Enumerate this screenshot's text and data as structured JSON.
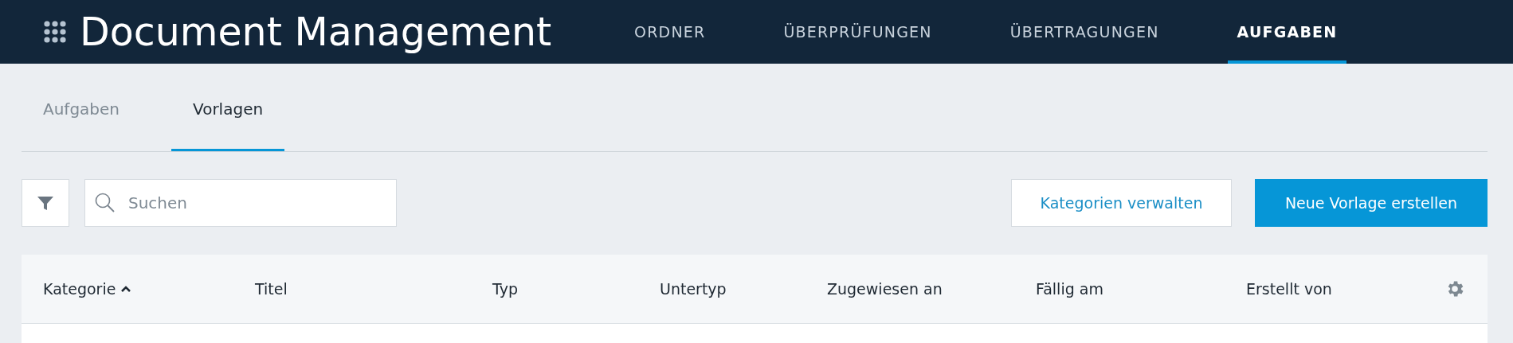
{
  "app": {
    "title": "Document Management"
  },
  "nav_tabs": [
    {
      "label": "ORDNER",
      "selected": false
    },
    {
      "label": "ÜBERPRÜFUNGEN",
      "selected": false
    },
    {
      "label": "ÜBERTRAGUNGEN",
      "selected": false
    },
    {
      "label": "AUFGABEN",
      "selected": true
    }
  ],
  "sub_tabs": [
    {
      "label": "Aufgaben",
      "selected": false
    },
    {
      "label": "Vorlagen",
      "selected": true
    }
  ],
  "search": {
    "placeholder": "Suchen"
  },
  "buttons": [
    {
      "label": "Kategorien verwalten",
      "kind": "secondary"
    },
    {
      "label": "Neue Vorlage erstellen",
      "kind": "primary"
    }
  ],
  "table": {
    "columns": [
      {
        "label": "Kategorie",
        "sorted": true
      },
      {
        "label": "Titel",
        "sorted": false
      },
      {
        "label": "Typ",
        "sorted": false
      },
      {
        "label": "Untertyp",
        "sorted": false
      },
      {
        "label": "Zugewiesen an",
        "sorted": false
      },
      {
        "label": "Fällig am",
        "sorted": false
      },
      {
        "label": "Erstellt von",
        "sorted": false
      }
    ]
  }
}
